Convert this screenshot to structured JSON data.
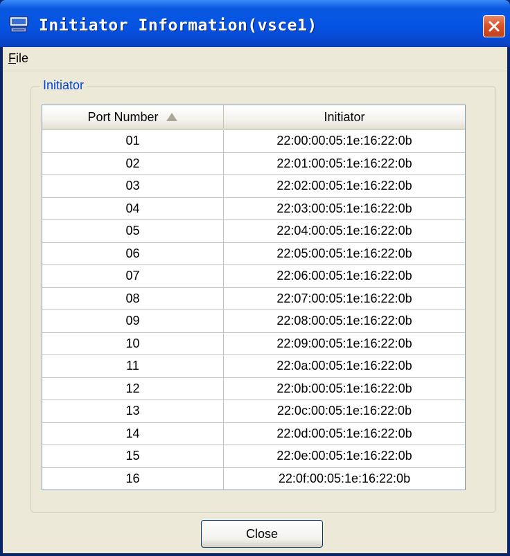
{
  "window": {
    "title": "Initiator Information(vsce1)"
  },
  "menu": {
    "file": {
      "mnemonic": "F",
      "rest": "ile"
    }
  },
  "group": {
    "label": "Initiator"
  },
  "table": {
    "columns": [
      "Port Number",
      "Initiator"
    ],
    "sort": {
      "column": "Port Number",
      "direction": "ascending"
    },
    "rows": [
      {
        "port": "01",
        "initiator": "22:00:00:05:1e:16:22:0b"
      },
      {
        "port": "02",
        "initiator": "22:01:00:05:1e:16:22:0b"
      },
      {
        "port": "03",
        "initiator": "22:02:00:05:1e:16:22:0b"
      },
      {
        "port": "04",
        "initiator": "22:03:00:05:1e:16:22:0b"
      },
      {
        "port": "05",
        "initiator": "22:04:00:05:1e:16:22:0b"
      },
      {
        "port": "06",
        "initiator": "22:05:00:05:1e:16:22:0b"
      },
      {
        "port": "07",
        "initiator": "22:06:00:05:1e:16:22:0b"
      },
      {
        "port": "08",
        "initiator": "22:07:00:05:1e:16:22:0b"
      },
      {
        "port": "09",
        "initiator": "22:08:00:05:1e:16:22:0b"
      },
      {
        "port": "10",
        "initiator": "22:09:00:05:1e:16:22:0b"
      },
      {
        "port": "11",
        "initiator": "22:0a:00:05:1e:16:22:0b"
      },
      {
        "port": "12",
        "initiator": "22:0b:00:05:1e:16:22:0b"
      },
      {
        "port": "13",
        "initiator": "22:0c:00:05:1e:16:22:0b"
      },
      {
        "port": "14",
        "initiator": "22:0d:00:05:1e:16:22:0b"
      },
      {
        "port": "15",
        "initiator": "22:0e:00:05:1e:16:22:0b"
      },
      {
        "port": "16",
        "initiator": "22:0f:00:05:1e:16:22:0b"
      }
    ]
  },
  "buttons": {
    "close": "Close"
  },
  "icons": {
    "app": "server-icon",
    "titlebar_close": "close-x-icon",
    "sort": "sort-ascending-icon"
  },
  "colors": {
    "titlebar": "#0554E3",
    "close_button": "#D9542B",
    "group_label": "#0046D5",
    "window_bg": "#ECE9D8"
  }
}
